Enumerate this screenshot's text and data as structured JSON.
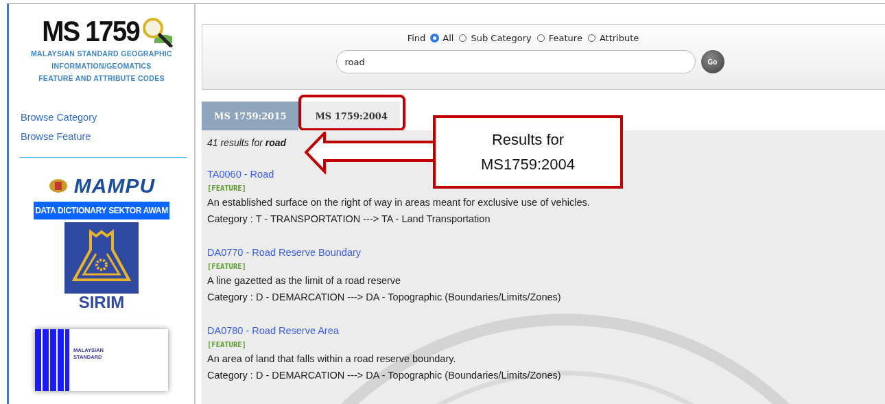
{
  "logo": {
    "title": "MS 1759",
    "subtitle": [
      "MALAYSIAN STANDARD GEOGRAPHIC",
      "INFORMATION/GEOMATICS",
      "FEATURE AND ATTRIBUTE CODES"
    ]
  },
  "sidebar": {
    "links": [
      "Browse Category",
      "Browse Feature"
    ],
    "partners": {
      "mampu": "MAMPU",
      "banner": "DATA DICTIONARY SEKTOR AWAM",
      "sirim": "SIRIM",
      "cover": [
        "MALAYSIAN",
        "STANDARD"
      ]
    }
  },
  "search": {
    "find_label": "Find",
    "options": [
      {
        "label": "All",
        "selected": true
      },
      {
        "label": "Sub Category",
        "selected": false
      },
      {
        "label": "Feature",
        "selected": false
      },
      {
        "label": "Attribute",
        "selected": false
      }
    ],
    "query": "road",
    "go": "Go"
  },
  "tabs": [
    {
      "label": "MS 1759:2015",
      "selected": false
    },
    {
      "label": "MS 1759:2004",
      "selected": true
    }
  ],
  "results_summary": "41 results for **road**",
  "results": [
    {
      "title": "TA0060 - Road",
      "type": "[FEATURE]",
      "description": "An established surface on the right of way in areas meant for exclusive use of vehicles.",
      "category": "Category : T - TRANSPORTATION ---> TA - Land Transportation"
    },
    {
      "title": "DA0770 - Road Reserve Boundary",
      "type": "[FEATURE]",
      "description": "A line gazetted as the limit of a road reserve",
      "category": "Category : D - DEMARCATION ---> DA - Topographic (Boundaries/Limits/Zones)"
    },
    {
      "title": "DA0780 - Road Reserve Area",
      "type": "[FEATURE]",
      "description": "An area of land that falls within a road reserve boundary.",
      "category": "Category : D - DEMARCATION ---> DA - Topographic (Boundaries/Limits/Zones)"
    }
  ],
  "callout": {
    "lines": [
      "Results for",
      "MS1759:2004"
    ]
  }
}
